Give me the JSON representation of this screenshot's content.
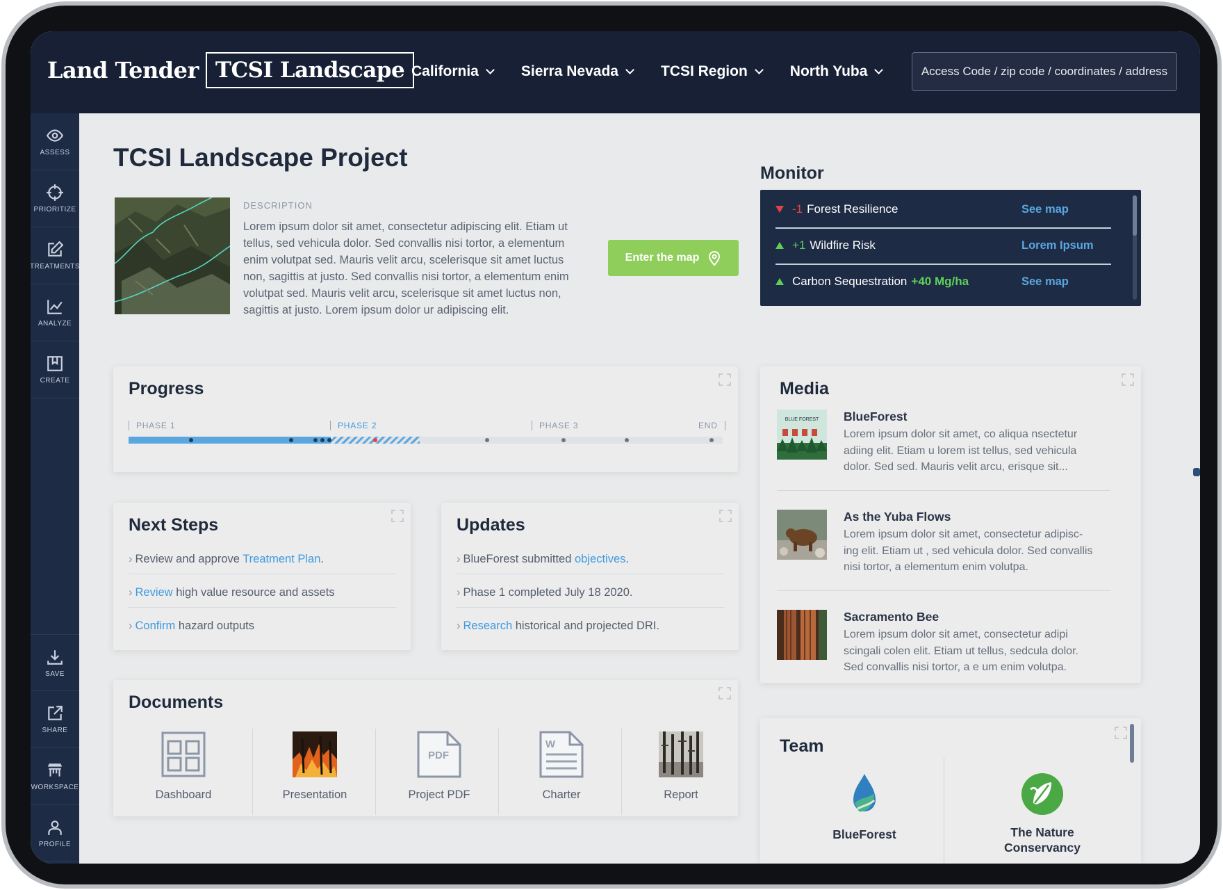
{
  "header": {
    "brand_name": "Land Tender",
    "brand_box": "TCSI Landscape",
    "nav": [
      {
        "label": "California"
      },
      {
        "label": "Sierra Nevada"
      },
      {
        "label": "TCSI Region"
      },
      {
        "label": "North Yuba"
      }
    ],
    "access_placeholder": "Access Code / zip code / coordinates / address"
  },
  "sidebar": {
    "top": [
      {
        "label": "ASSESS",
        "icon": "eye-icon"
      },
      {
        "label": "PRIORITIZE",
        "icon": "crosshair-icon"
      },
      {
        "label": "TREATMENTS",
        "icon": "edit-icon"
      },
      {
        "label": "ANALYZE",
        "icon": "chart-icon"
      },
      {
        "label": "CREATE",
        "icon": "bookmark-icon"
      }
    ],
    "bottom": [
      {
        "label": "SAVE",
        "icon": "download-icon"
      },
      {
        "label": "SHARE",
        "icon": "share-icon"
      },
      {
        "label": "WORKSPACE",
        "icon": "workspace-icon"
      },
      {
        "label": "PROFILE",
        "icon": "user-icon"
      }
    ]
  },
  "project": {
    "title": "TCSI Landscape Project",
    "description_label": "DESCRIPTION",
    "description": "Lorem ipsum dolor sit amet, consectetur adipiscing elit. Etiam ut tellus, sed vehicula dolor. Sed convallis nisi tortor, a elementum enim volutpat sed. Mauris velit arcu, scelerisque sit amet luctus non, sagittis at justo. Sed convallis nisi tortor, a elementum enim volutpat sed. Mauris velit arcu, scelerisque sit amet luctus non, sagittis at justo. Lorem ipsum dolor ur adipiscing elit.",
    "enter_map": "Enter the map"
  },
  "progress": {
    "title": "Progress",
    "phases": [
      "PHASE 1",
      "PHASE 2",
      "PHASE 3",
      "END"
    ],
    "completed_fraction": 0.34,
    "in_progress_fraction": 0.15
  },
  "next_steps": {
    "title": "Next Steps",
    "items": [
      {
        "pre": "Review and approve ",
        "link": "Treatment Plan",
        "post": "."
      },
      {
        "pre": "",
        "link": "Review",
        "post": " high value resource and assets"
      },
      {
        "pre": "",
        "link": "Confirm",
        "post": " hazard outputs"
      }
    ]
  },
  "updates": {
    "title": "Updates",
    "items": [
      {
        "pre": "BlueForest submitted ",
        "link": "objectives",
        "post": "."
      },
      {
        "pre": "Phase 1 completed July 18 2020.",
        "link": "",
        "post": ""
      },
      {
        "pre": "",
        "link": "Research",
        "post": " historical and projected DRI."
      }
    ]
  },
  "documents": {
    "title": "Documents",
    "items": [
      {
        "label": "Dashboard"
      },
      {
        "label": "Presentation"
      },
      {
        "label": "Project PDF",
        "icon_text": "PDF"
      },
      {
        "label": "Charter",
        "icon_text": "W"
      },
      {
        "label": "Report"
      }
    ]
  },
  "monitor": {
    "title": "Monitor",
    "rows": [
      {
        "trend": "down",
        "delta": "-1",
        "label": "Forest Resilience",
        "suffix": "",
        "link": "See map"
      },
      {
        "trend": "up",
        "delta": "+1",
        "label": "Wildfire Risk",
        "suffix": "",
        "link": "Lorem Ipsum"
      },
      {
        "trend": "up",
        "delta": "",
        "label": "Carbon Sequestration",
        "suffix": "+40 Mg/ha",
        "link": "See map"
      }
    ],
    "colors": {
      "down": "#e54343",
      "up": "#5ccf5a",
      "link": "#5aa7e0"
    }
  },
  "media": {
    "title": "Media",
    "items": [
      {
        "title": "BlueForest",
        "text": "Lorem ipsum dolor sit amet, co aliqua nsectetur adiing elit. Etiam u lorem ist tellus, sed vehicula dolor. Sed sed. Mauris velit arcu, erisque sit...",
        "thumb_text": "BLUE FOREST"
      },
      {
        "title": "As the Yuba Flows",
        "text": "Lorem ipsum dolor sit amet, consectetur adipisc-ing elit. Etiam ut , sed vehicula dolor. Sed convallis nisi tortor, a elementum enim volutpa."
      },
      {
        "title": "Sacramento Bee",
        "text": "Lorem ipsum dolor sit amet, consectetur adipi scingali colen elit. Etiam ut tellus, sedcula dolor. Sed convallis nisi tortor, a e um enim volutpa."
      }
    ]
  },
  "team": {
    "title": "Team",
    "members": [
      {
        "name": "BlueForest"
      },
      {
        "name": "The Nature Conservancy"
      }
    ]
  }
}
